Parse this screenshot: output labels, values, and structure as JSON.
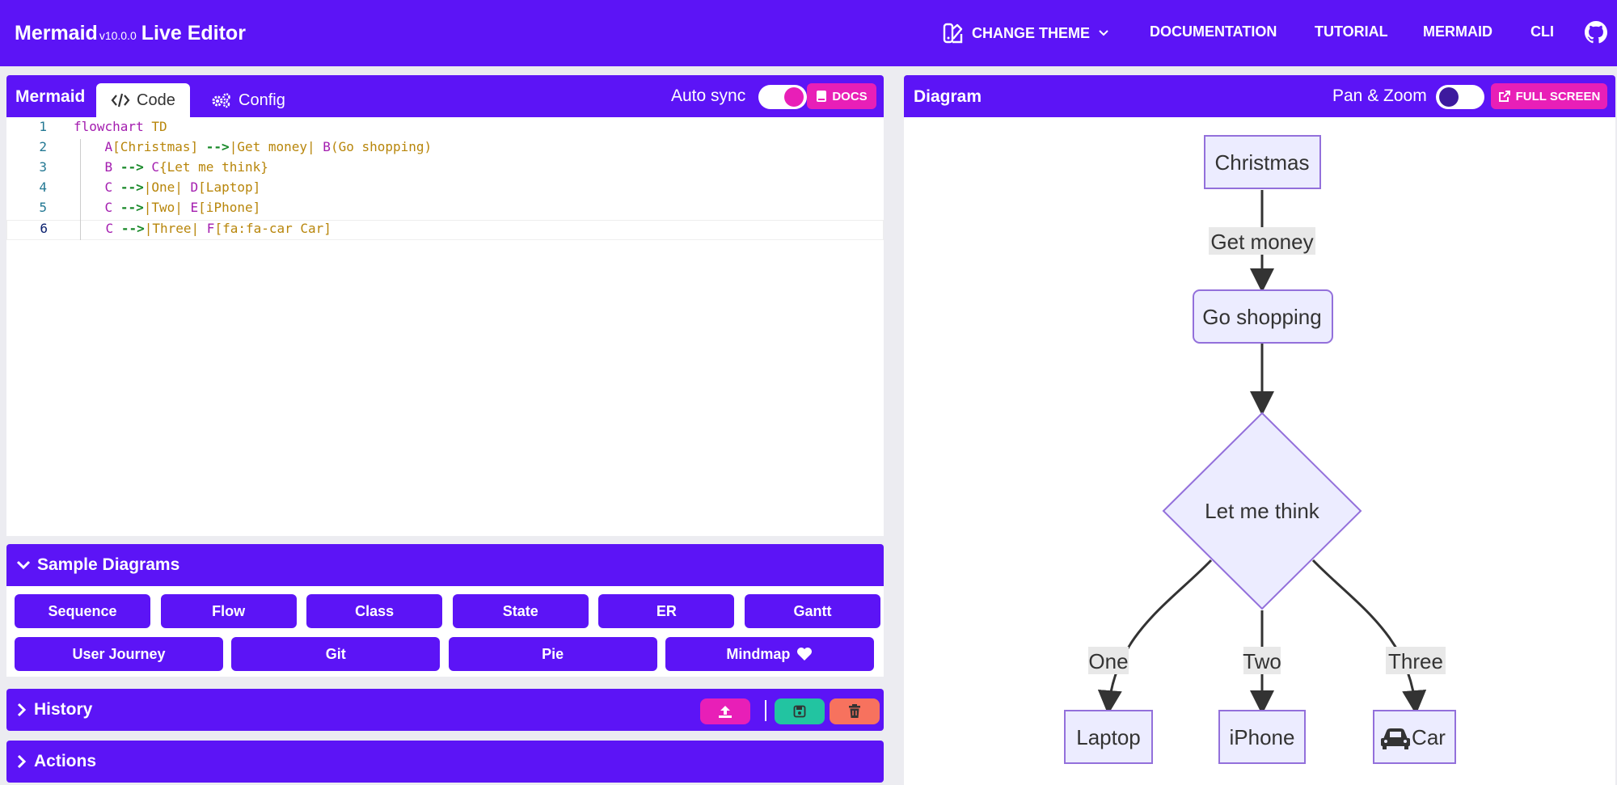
{
  "app": {
    "brand": "Mermaid",
    "version": "v10.0.0",
    "title": "Live Editor"
  },
  "nav": {
    "theme": "CHANGE THEME",
    "documentation": "DOCUMENTATION",
    "tutorial": "TUTORIAL",
    "mermaid": "MERMAID",
    "cli": "CLI"
  },
  "editor": {
    "title": "Mermaid",
    "tabs": [
      "Code",
      "Config"
    ],
    "autosync_label": "Auto sync",
    "autosync_on": true,
    "docs_label": "DOCS",
    "lines": [
      {
        "n": "1",
        "parts": [
          [
            "kw",
            "flowchart"
          ],
          [
            "plain",
            " "
          ],
          [
            "txt",
            "TD"
          ]
        ]
      },
      {
        "n": "2",
        "parts": [
          [
            "plain",
            "    "
          ],
          [
            "id",
            "A"
          ],
          [
            "txt",
            "[Christmas]"
          ],
          [
            "plain",
            " "
          ],
          [
            "arrow",
            "-->"
          ],
          [
            "txt",
            "|Get money|"
          ],
          [
            "plain",
            " "
          ],
          [
            "id",
            "B"
          ],
          [
            "txt",
            "(Go shopping)"
          ]
        ]
      },
      {
        "n": "3",
        "parts": [
          [
            "plain",
            "    "
          ],
          [
            "id",
            "B"
          ],
          [
            "plain",
            " "
          ],
          [
            "arrow",
            "-->"
          ],
          [
            "plain",
            " "
          ],
          [
            "id",
            "C"
          ],
          [
            "txt",
            "{Let me think}"
          ]
        ]
      },
      {
        "n": "4",
        "parts": [
          [
            "plain",
            "    "
          ],
          [
            "id",
            "C"
          ],
          [
            "plain",
            " "
          ],
          [
            "arrow",
            "-->"
          ],
          [
            "txt",
            "|One|"
          ],
          [
            "plain",
            " "
          ],
          [
            "id",
            "D"
          ],
          [
            "txt",
            "[Laptop]"
          ]
        ]
      },
      {
        "n": "5",
        "parts": [
          [
            "plain",
            "    "
          ],
          [
            "id",
            "C"
          ],
          [
            "plain",
            " "
          ],
          [
            "arrow",
            "-->"
          ],
          [
            "txt",
            "|Two|"
          ],
          [
            "plain",
            " "
          ],
          [
            "id",
            "E"
          ],
          [
            "txt",
            "[iPhone]"
          ]
        ]
      },
      {
        "n": "6",
        "parts": [
          [
            "plain",
            "    "
          ],
          [
            "id",
            "C"
          ],
          [
            "plain",
            " "
          ],
          [
            "arrow",
            "-->"
          ],
          [
            "txt",
            "|Three|"
          ],
          [
            "plain",
            " "
          ],
          [
            "id",
            "F"
          ],
          [
            "txt",
            "[fa:fa-car Car]"
          ]
        ]
      }
    ]
  },
  "samples": {
    "title": "Sample Diagrams",
    "row1": [
      "Sequence",
      "Flow",
      "Class",
      "State",
      "ER",
      "Gantt"
    ],
    "row2": [
      "User Journey",
      "Git",
      "Pie",
      "Mindmap"
    ]
  },
  "history": {
    "title": "History"
  },
  "actions": {
    "title": "Actions"
  },
  "diagram": {
    "title": "Diagram",
    "panzoom_label": "Pan & Zoom",
    "panzoom_on": false,
    "fullscreen_label": "FULL SCREEN",
    "nodes": {
      "a": "Christmas",
      "b": "Go shopping",
      "c": "Let me think",
      "d": "Laptop",
      "e": "iPhone",
      "f": "Car"
    },
    "edges": {
      "ab": "Get money",
      "cd": "One",
      "ce": "Two",
      "cf": "Three"
    }
  },
  "colors": {
    "primary": "#5c14f6",
    "accent": "#e81fb7",
    "save": "#22c4a1",
    "delete": "#f7725e",
    "node_fill": "#ececff",
    "node_stroke": "#9370db"
  }
}
